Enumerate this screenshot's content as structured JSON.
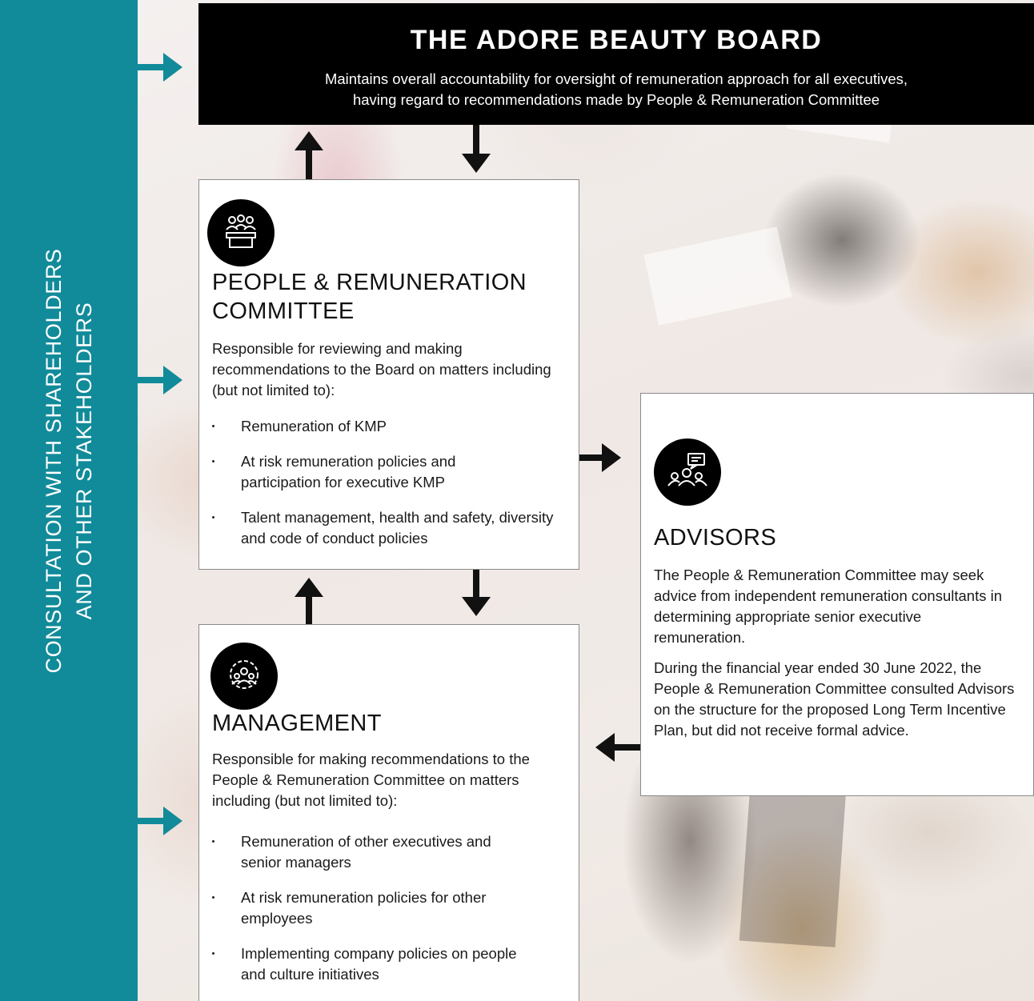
{
  "sidebar": {
    "line1": "CONSULTATION WITH SHAREHOLDERS",
    "line2": "AND OTHER STAKEHOLDERS"
  },
  "board": {
    "title": "THE ADORE BEAUTY BOARD",
    "line1": "Maintains overall accountability for oversight of remuneration approach for all executives,",
    "line2": "having regard to recommendations made by People & Remuneration Committee"
  },
  "committee": {
    "icon": "committee-meeting-icon",
    "title_line1": "PEOPLE & REMUNERATION",
    "title_line2": "COMMITTEE",
    "intro": "Responsible for reviewing and making recommendations to the Board on matters including (but not limited to):",
    "bullets": [
      "Remuneration of KMP",
      "At risk remuneration policies and participation for executive KMP",
      "Talent management, health and safety, diversity and code of conduct policies"
    ]
  },
  "management": {
    "icon": "team-gear-icon",
    "title": "MANAGEMENT",
    "intro": "Responsible for making recommendations to the People & Remuneration Committee on matters including (but not limited to):",
    "bullets": [
      "Remuneration of other executives and senior managers",
      "At risk remuneration policies for other employees",
      "Implementing company policies on people and culture initiatives"
    ]
  },
  "advisors": {
    "icon": "advisors-discussion-icon",
    "title": "ADVISORS",
    "para1": "The People & Remuneration Committee may seek advice from independent remuneration consultants in determining appropriate senior executive remuneration.",
    "para2": "During the financial year ended 30 June 2022, the People & Remuneration Committee consulted Advisors on the structure for the proposed Long Term Incentive Plan, but did not receive formal advice."
  },
  "colors": {
    "sidebar": "#118a99",
    "board_bg": "#000000",
    "arrow_black": "#111111"
  }
}
